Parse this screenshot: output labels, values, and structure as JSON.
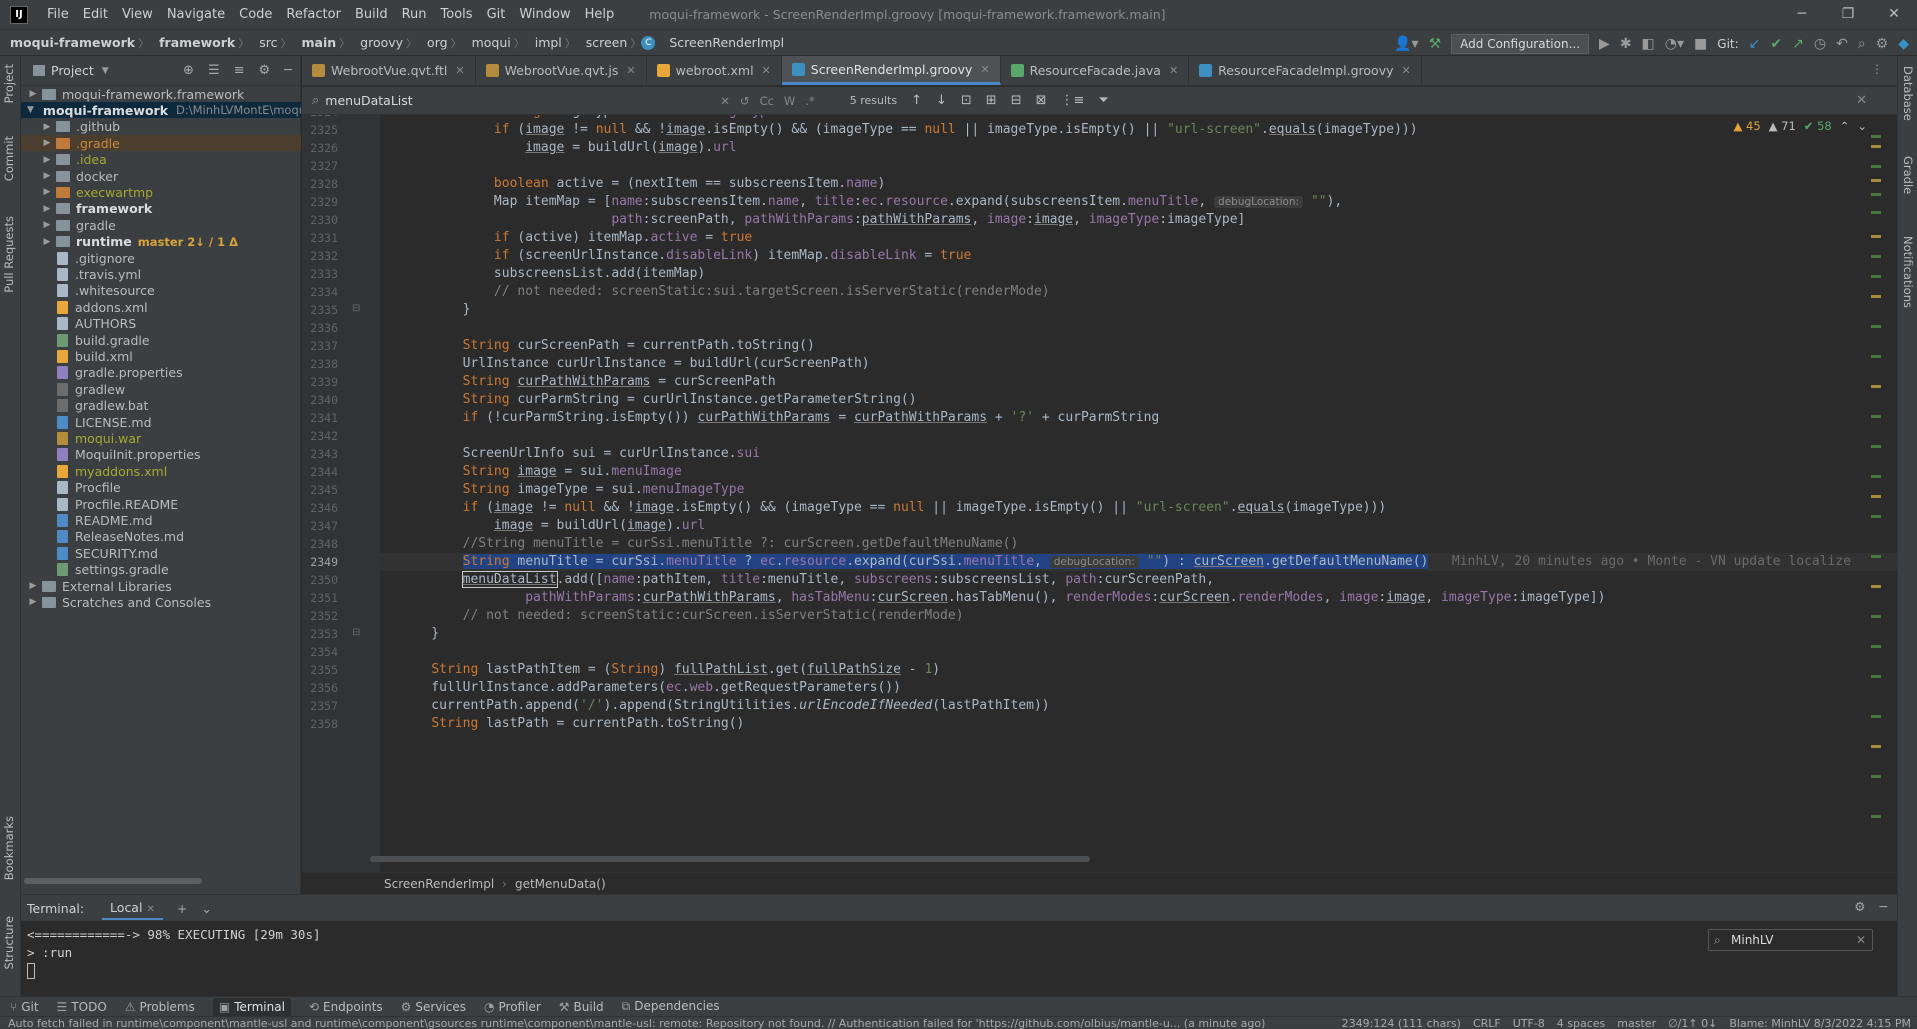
{
  "menubar": {
    "logo": "IJ",
    "items": [
      "File",
      "Edit",
      "View",
      "Navigate",
      "Code",
      "Refactor",
      "Build",
      "Run",
      "Tools",
      "Git",
      "Window",
      "Help"
    ],
    "window_title": "moqui-framework - ScreenRenderImpl.groovy [moqui-framework.framework.main]"
  },
  "navbar": {
    "crumbs": [
      "moqui-framework",
      "framework",
      "src",
      "main",
      "groovy",
      "org",
      "moqui",
      "impl",
      "screen",
      "ScreenRenderImpl"
    ],
    "add_config": "Add Configuration...",
    "git_label": "Git:"
  },
  "left_strip": [
    "Project",
    "Commit",
    "Pull Requests",
    "Bookmarks",
    "Structure"
  ],
  "right_strip": [
    "Database",
    "Gradle",
    "Notifications"
  ],
  "project": {
    "title": "Project",
    "rows": [
      {
        "label": "moqui-framework.framework",
        "arrow": "▶",
        "indent": 0,
        "kind": "folder",
        "style": ""
      },
      {
        "label": "moqui-framework",
        "path": "D:\\MinhLVMontE\\moqui",
        "arrow": "▼",
        "indent": 0,
        "kind": "folder",
        "style": "bold",
        "selected": true
      },
      {
        "label": ".github",
        "arrow": "▶",
        "indent": 1,
        "kind": "folder",
        "style": ""
      },
      {
        "label": ".gradle",
        "arrow": "▶",
        "indent": 1,
        "kind": "folder-orange",
        "style": "orange",
        "highlighted": true
      },
      {
        "label": ".idea",
        "arrow": "▶",
        "indent": 1,
        "kind": "folder",
        "style": "olive"
      },
      {
        "label": "docker",
        "arrow": "▶",
        "indent": 1,
        "kind": "folder",
        "style": ""
      },
      {
        "label": "execwartmp",
        "arrow": "▶",
        "indent": 1,
        "kind": "folder-orange",
        "style": "olive"
      },
      {
        "label": "framework",
        "arrow": "▶",
        "indent": 1,
        "kind": "folder",
        "style": "bold"
      },
      {
        "label": "gradle",
        "arrow": "▶",
        "indent": 1,
        "kind": "folder",
        "style": ""
      },
      {
        "label": "runtime",
        "branch": "master 2↓ / 1 Δ",
        "arrow": "▶",
        "indent": 1,
        "kind": "folder",
        "style": "bold"
      },
      {
        "label": ".gitignore",
        "indent": 1,
        "kind": "file",
        "style": ""
      },
      {
        "label": ".travis.yml",
        "indent": 1,
        "kind": "file",
        "style": ""
      },
      {
        "label": ".whitesource",
        "indent": 1,
        "kind": "file",
        "style": ""
      },
      {
        "label": "addons.xml",
        "indent": 1,
        "kind": "xml",
        "style": ""
      },
      {
        "label": "AUTHORS",
        "indent": 1,
        "kind": "file",
        "style": ""
      },
      {
        "label": "build.gradle",
        "indent": 1,
        "kind": "grad",
        "style": ""
      },
      {
        "label": "build.xml",
        "indent": 1,
        "kind": "xml",
        "style": ""
      },
      {
        "label": "gradle.properties",
        "indent": 1,
        "kind": "prop",
        "style": ""
      },
      {
        "label": "gradlew",
        "indent": 1,
        "kind": "bat",
        "style": ""
      },
      {
        "label": "gradlew.bat",
        "indent": 1,
        "kind": "bat",
        "style": ""
      },
      {
        "label": "LICENSE.md",
        "indent": 1,
        "kind": "md",
        "style": ""
      },
      {
        "label": "moqui.war",
        "indent": 1,
        "kind": "war",
        "style": "olive"
      },
      {
        "label": "MoquiInit.properties",
        "indent": 1,
        "kind": "prop",
        "style": ""
      },
      {
        "label": "myaddons.xml",
        "indent": 1,
        "kind": "xml",
        "style": "olive"
      },
      {
        "label": "Procfile",
        "indent": 1,
        "kind": "file",
        "style": ""
      },
      {
        "label": "Procfile.README",
        "indent": 1,
        "kind": "file",
        "style": ""
      },
      {
        "label": "README.md",
        "indent": 1,
        "kind": "md",
        "style": ""
      },
      {
        "label": "ReleaseNotes.md",
        "indent": 1,
        "kind": "md",
        "style": ""
      },
      {
        "label": "SECURITY.md",
        "indent": 1,
        "kind": "md",
        "style": ""
      },
      {
        "label": "settings.gradle",
        "indent": 1,
        "kind": "grad",
        "style": ""
      },
      {
        "label": "External Libraries",
        "arrow": "▶",
        "indent": 0,
        "kind": "lib",
        "style": ""
      },
      {
        "label": "Scratches and Consoles",
        "arrow": "▶",
        "indent": 0,
        "kind": "scratch",
        "style": ""
      }
    ]
  },
  "tabs": [
    {
      "label": "WebrootVue.qvt.ftl",
      "icon_color": "#b58b3d",
      "active": false
    },
    {
      "label": "WebrootVue.qvt.js",
      "icon_color": "#b58b3d",
      "active": false
    },
    {
      "label": "webroot.xml",
      "icon_color": "#e8a73b",
      "active": false
    },
    {
      "label": "ScreenRenderImpl.groovy",
      "icon_color": "#3d8fc0",
      "active": true
    },
    {
      "label": "ResourceFacade.java",
      "icon_color": "#59a869",
      "active": false
    },
    {
      "label": "ResourceFacadeImpl.groovy",
      "icon_color": "#3d8fc0",
      "active": false
    }
  ],
  "findbar": {
    "query": "menuDataList",
    "results": "5 results",
    "opts": [
      "Cc",
      "W",
      ".*"
    ]
  },
  "inspections": {
    "warnings": "45",
    "weak": "71",
    "ok": "58"
  },
  "editor": {
    "first_line": 2324,
    "current_line": 2349,
    "lines": [
      "            <span class=\"k\">String</span> imageType = sui.<span class=\"f\">menuImageType</span>",
      "            <span class=\"k\">if</span> (<span class=\"u\">image</span> != <span class=\"k\">null</span> &amp;&amp; !<span class=\"u\">image</span>.isEmpty() &amp;&amp; (imageType == <span class=\"k\">null</span> || imageType.isEmpty() || <span class=\"s\">\"url-screen\"</span>.<span class=\"u\">equals</span>(imageType)))",
      "                <span class=\"u\">image</span> = buildUrl(<span class=\"u\">image</span>).<span class=\"f\">url</span>",
      "",
      "            <span class=\"k\">boolean</span> active = (nextItem == subscreensItem.<span class=\"f\">name</span>)",
      "            Map itemMap = [<span class=\"f\">name</span>:subscreensItem.<span class=\"f\">name</span>, <span class=\"f\">title</span>:<span class=\"f\">ec</span>.<span class=\"f\">resource</span>.expand(subscreensItem.<span class=\"f\">menuTitle</span>, <span class=\"hint\">debugLocation:</span> <span class=\"s\">\"\"</span>),",
      "                           <span class=\"f\">path</span>:screenPath, <span class=\"f\">pathWithParams</span>:<span class=\"u\">pathWithParams</span>, <span class=\"f\">image</span>:<span class=\"u\">image</span>, <span class=\"f\">imageType</span>:imageType]",
      "            <span class=\"k\">if</span> (active) itemMap.<span class=\"f\">active</span> = <span class=\"k\">true</span>",
      "            <span class=\"k\">if</span> (screenUrlInstance.<span class=\"f\">disableLink</span>) itemMap.<span class=\"f\">disableLink</span> = <span class=\"k\">true</span>",
      "            subscreensList.add(itemMap)",
      "            <span class=\"c\">// not needed: screenStatic:sui.targetScreen.isServerStatic(renderMode)</span>",
      "        }",
      "",
      "        <span class=\"k\">String</span> curScreenPath = currentPath.toString()",
      "        UrlInstance curUrlInstance = buildUrl(curScreenPath)",
      "        <span class=\"k\">String</span> <span class=\"u\">curPathWithParams</span> = curScreenPath",
      "        <span class=\"k\">String</span> curParmString = curUrlInstance.getParameterString()",
      "        <span class=\"k\">if</span> (!curParmString.isEmpty()) <span class=\"u\">curPathWithParams</span> = <span class=\"u\">curPathWithParams</span> + <span class=\"s\">'?'</span> + curParmString",
      "",
      "        ScreenUrlInfo sui = curUrlInstance.<span class=\"f\">sui</span>",
      "        <span class=\"k\">String</span> <span class=\"u\">image</span> = sui.<span class=\"f\">menuImage</span>",
      "        <span class=\"k\">String</span> imageType = sui.<span class=\"f\">menuImageType</span>",
      "        <span class=\"k\">if</span> (<span class=\"u\">image</span> != <span class=\"k\">null</span> &amp;&amp; !<span class=\"u\">image</span>.isEmpty() &amp;&amp; (imageType == <span class=\"k\">null</span> || imageType.isEmpty() || <span class=\"s\">\"url-screen\"</span>.<span class=\"u\">equals</span>(imageType)))",
      "            <span class=\"u\">image</span> = buildUrl(<span class=\"u\">image</span>).<span class=\"f\">url</span>",
      "        <span class=\"c\">//String menuTitle = curSsi.menuTitle ?: curScreen.getDefaultMenuName()</span>",
      "        <span class=\"sel\"><span class=\"k\">String</span> menuTitle = curSsi.<span class=\"f\">menuTitle</span> ? <span class=\"f\">ec</span>.<span class=\"f\">resource</span>.expand(curSsi.<span class=\"f\">menuTitle</span>, <span class=\"hint\">debugLocation:</span> <span class=\"s\">\"\"</span>) : <span class=\"u\">curScreen</span>.getDefaultMenuName()</span>   <span class=\"blame\">MinhLV, 20 minutes ago • Monte - VN update localize</span>",
      "        <span class=\"ident-box u\">menuDataList</span>.add([<span class=\"f\">name</span>:pathItem, <span class=\"f\">title</span>:menuTitle, <span class=\"f\">subscreens</span>:subscreensList, <span class=\"f\">path</span>:curScreenPath,",
      "                <span class=\"f\">pathWithParams</span>:<span class=\"u\">curPathWithParams</span>, <span class=\"f\">hasTabMenu</span>:<span class=\"u\">curScreen</span>.hasTabMenu(), <span class=\"f\">renderModes</span>:<span class=\"u\">curScreen</span>.<span class=\"f\">renderModes</span>, <span class=\"f\">image</span>:<span class=\"u\">image</span>, <span class=\"f\">imageType</span>:imageType])",
      "        <span class=\"c\">// not needed: screenStatic:curScreen.isServerStatic(renderMode)</span>",
      "    }",
      "",
      "    <span class=\"k\">String</span> lastPathItem = (<span class=\"k\">String</span>) <span class=\"u\">fullPathList</span>.get(<span class=\"u\">fullPathSize</span> - <span class=\"s\">1</span>)",
      "    fullUrlInstance.addParameters(<span class=\"f\">ec</span>.<span class=\"f\">web</span>.getRequestParameters())",
      "    currentPath.append(<span class=\"s\">'/'</span>).append(StringUtilities.<span class=\"it\">urlEncodeIfNeeded</span>(lastPathItem))",
      "    <span class=\"k\">String</span> lastPath = currentPath.toString()"
    ]
  },
  "edcrumb": [
    "ScreenRenderImpl",
    "getMenuData()"
  ],
  "terminal": {
    "title": "Terminal:",
    "tab": "Local",
    "lines": [
      "<============-> 98% EXECUTING [29m 30s]",
      "> :run"
    ],
    "search": "MinhLV"
  },
  "tooltabs": [
    "Git",
    "TODO",
    "Problems",
    "Terminal",
    "Endpoints",
    "Services",
    "Profiler",
    "Build",
    "Dependencies"
  ],
  "status": {
    "message": "Auto fetch failed in runtime\\component\\mantle-usl and runtime\\component\\gsources runtime\\component\\mantle-usl: remote: Repository not found. // Authentication failed for 'https://github.com/olbius/mantle-u... (a minute ago)",
    "right": [
      "2349:124 (111 chars)",
      "CRLF",
      "UTF-8",
      "4 spaces",
      "master",
      "∅/1↑ 0↓",
      "Blame: MinhLV 8/3/2022 4:15 PM"
    ]
  }
}
